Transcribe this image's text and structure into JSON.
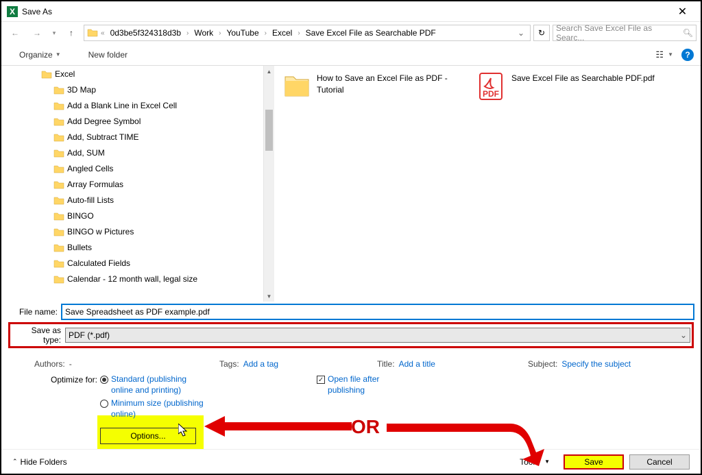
{
  "window": {
    "title": "Save As"
  },
  "breadcrumb": {
    "prefix": "«",
    "items": [
      "0d3be5f324318d3b",
      "Work",
      "YouTube",
      "Excel",
      "Save Excel File as Searchable PDF"
    ]
  },
  "search": {
    "placeholder": "Search Save Excel File as Searc..."
  },
  "toolbar": {
    "organize": "Organize",
    "newfolder": "New folder"
  },
  "tree": {
    "root": "Excel",
    "children": [
      "3D Map",
      "Add a Blank Line in Excel Cell",
      "Add Degree Symbol",
      "Add, Subtract TIME",
      "Add, SUM",
      "Angled Cells",
      "Array Formulas",
      "Auto-fill Lists",
      "BINGO",
      "BINGO w Pictures",
      "Bullets",
      "Calculated Fields",
      "Calendar - 12 month wall, legal size"
    ]
  },
  "content": {
    "items": [
      {
        "type": "folder",
        "label": "How to Save an Excel File as PDF - Tutorial"
      },
      {
        "type": "pdf",
        "label": "Save Excel File as Searchable PDF.pdf"
      }
    ]
  },
  "form": {
    "filename_label": "File name:",
    "filename_value": "Save Spreadsheet as PDF example.pdf",
    "type_label": "Save as type:",
    "type_value": "PDF (*.pdf)"
  },
  "meta": {
    "authors_label": "Authors:",
    "authors_value": "-",
    "tags_label": "Tags:",
    "tags_value": "Add a tag",
    "title_label": "Title:",
    "title_value": "Add a title",
    "subject_label": "Subject:",
    "subject_value": "Specify the subject"
  },
  "optimize": {
    "label": "Optimize for:",
    "opt1": "Standard (publishing online and printing)",
    "opt2": "Minimum size (publishing online)",
    "open_after": "Open file after publishing",
    "options_btn": "Options..."
  },
  "bottom": {
    "hide": "Hide Folders",
    "tools": "Tools",
    "save": "Save",
    "cancel": "Cancel"
  },
  "annotation": {
    "or": "OR"
  }
}
